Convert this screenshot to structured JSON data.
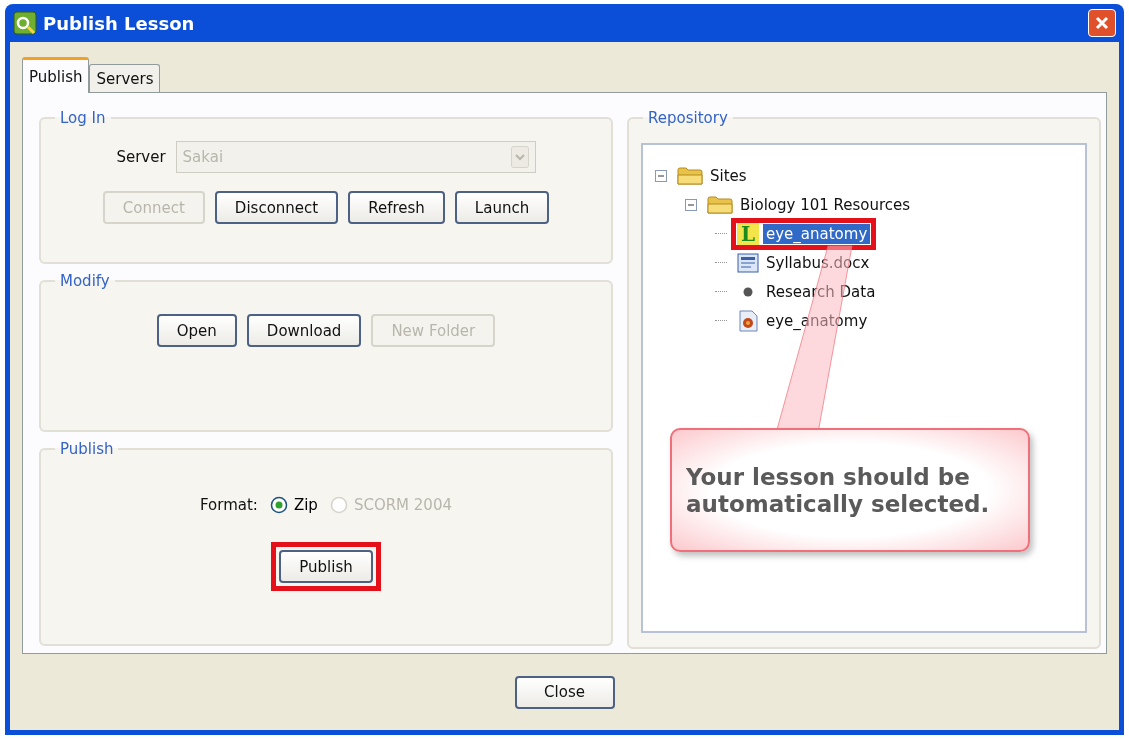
{
  "window": {
    "title": "Publish Lesson"
  },
  "tabs": [
    {
      "label": "Publish",
      "selected": true
    },
    {
      "label": "Servers",
      "selected": false
    }
  ],
  "login": {
    "title": "Log In",
    "server_label": "Server",
    "server": {
      "value": "Sakai",
      "disabled": true
    },
    "buttons": [
      {
        "label": "Connect",
        "disabled": true
      },
      {
        "label": "Disconnect",
        "disabled": false
      },
      {
        "label": "Refresh",
        "disabled": false
      },
      {
        "label": "Launch",
        "disabled": false
      }
    ]
  },
  "modify": {
    "title": "Modify",
    "buttons": [
      {
        "label": "Open",
        "disabled": false
      },
      {
        "label": "Download",
        "disabled": false
      },
      {
        "label": "New Folder",
        "disabled": true
      }
    ]
  },
  "publish": {
    "title": "Publish",
    "format_label": "Format:",
    "formats": [
      {
        "label": "Zip",
        "selected": true,
        "disabled": false
      },
      {
        "label": "SCORM 2004",
        "selected": false,
        "disabled": true
      }
    ],
    "button": {
      "label": "Publish",
      "highlighted": true
    }
  },
  "repository": {
    "title": "Repository",
    "tree": [
      {
        "label": "Sites",
        "kind": "folder",
        "expanded": true,
        "selected": false,
        "highlighted": false,
        "children": [
          {
            "label": "Biology 101 Resources",
            "kind": "folder",
            "expanded": true,
            "selected": false,
            "highlighted": false,
            "children": [
              {
                "label": "eye_anatomy",
                "kind": "lesson",
                "icon_letter": "L",
                "selected": true,
                "highlighted": true
              },
              {
                "label": "Syllabus.docx",
                "kind": "document",
                "selected": false,
                "highlighted": false
              },
              {
                "label": "Research Data",
                "kind": "bullet",
                "selected": false,
                "highlighted": false
              },
              {
                "label": "eye_anatomy",
                "kind": "media",
                "selected": false,
                "highlighted": false
              }
            ]
          }
        ]
      }
    ]
  },
  "callout": {
    "text": "Your lesson should be automatically selected."
  },
  "footer": {
    "close_button": "Close"
  }
}
